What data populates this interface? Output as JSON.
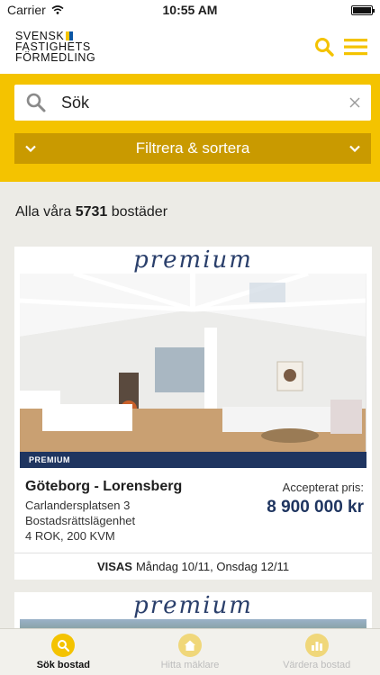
{
  "status_bar": {
    "carrier": "Carrier",
    "time": "10:55 AM"
  },
  "header": {
    "logo_lines": [
      "SVENSK",
      "FASTIGHETS",
      "FÖRMEDLING"
    ]
  },
  "search": {
    "placeholder": "Sök",
    "filter_label": "Filtrera & sortera"
  },
  "results": {
    "prefix": "Alla våra",
    "count": "5731",
    "suffix": "bostäder"
  },
  "listings": [
    {
      "premium_label": "premium",
      "badge": "PREMIUM",
      "title": "Göteborg - Lorensberg",
      "street": "Carlandersplatsen 3",
      "type": "Bostadsrättslägenhet",
      "size": "4 ROK, 200 KVM",
      "price_label": "Accepterat pris:",
      "price": "8 900 000 kr",
      "viewing_label": "VISAS",
      "viewing_dates": "Måndag 10/11, Onsdag 12/11"
    },
    {
      "premium_label": "premium"
    }
  ],
  "tabs": [
    {
      "label": "Sök bostad",
      "icon": "search-icon",
      "active": true
    },
    {
      "label": "Hitta mäklare",
      "icon": "house-icon",
      "active": false
    },
    {
      "label": "Värdera bostad",
      "icon": "bar-chart-icon",
      "active": false
    }
  ],
  "colors": {
    "accent": "#f4c300",
    "filter": "#c99a00",
    "navy": "#1f3560"
  }
}
